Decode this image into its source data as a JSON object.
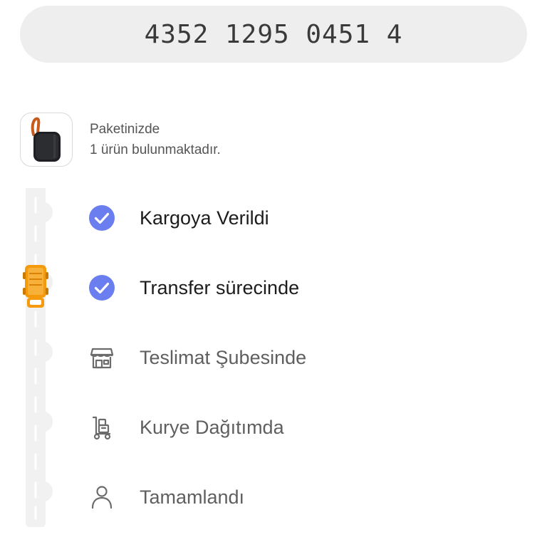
{
  "tracking": {
    "number": "4352 1295 0451 4"
  },
  "package": {
    "line1": "Paketinizde",
    "line2": "1 ürün bulunmaktadır."
  },
  "steps": [
    {
      "label": "Kargoya Verildi",
      "status": "done",
      "icon": "check-circle-icon"
    },
    {
      "label": "Transfer sürecinde",
      "status": "done",
      "icon": "check-circle-icon"
    },
    {
      "label": "Teslimat Şubesinde",
      "status": "pending",
      "icon": "store-icon"
    },
    {
      "label": "Kurye Dağıtımda",
      "status": "pending",
      "icon": "courier-dolly-icon"
    },
    {
      "label": "Tamamlandı",
      "status": "pending",
      "icon": "person-icon"
    }
  ],
  "colors": {
    "check": "#6a7ef0",
    "truck": "#f59a0c",
    "road": "#f1f1f1",
    "pending_icon": "#6b6b6b"
  }
}
